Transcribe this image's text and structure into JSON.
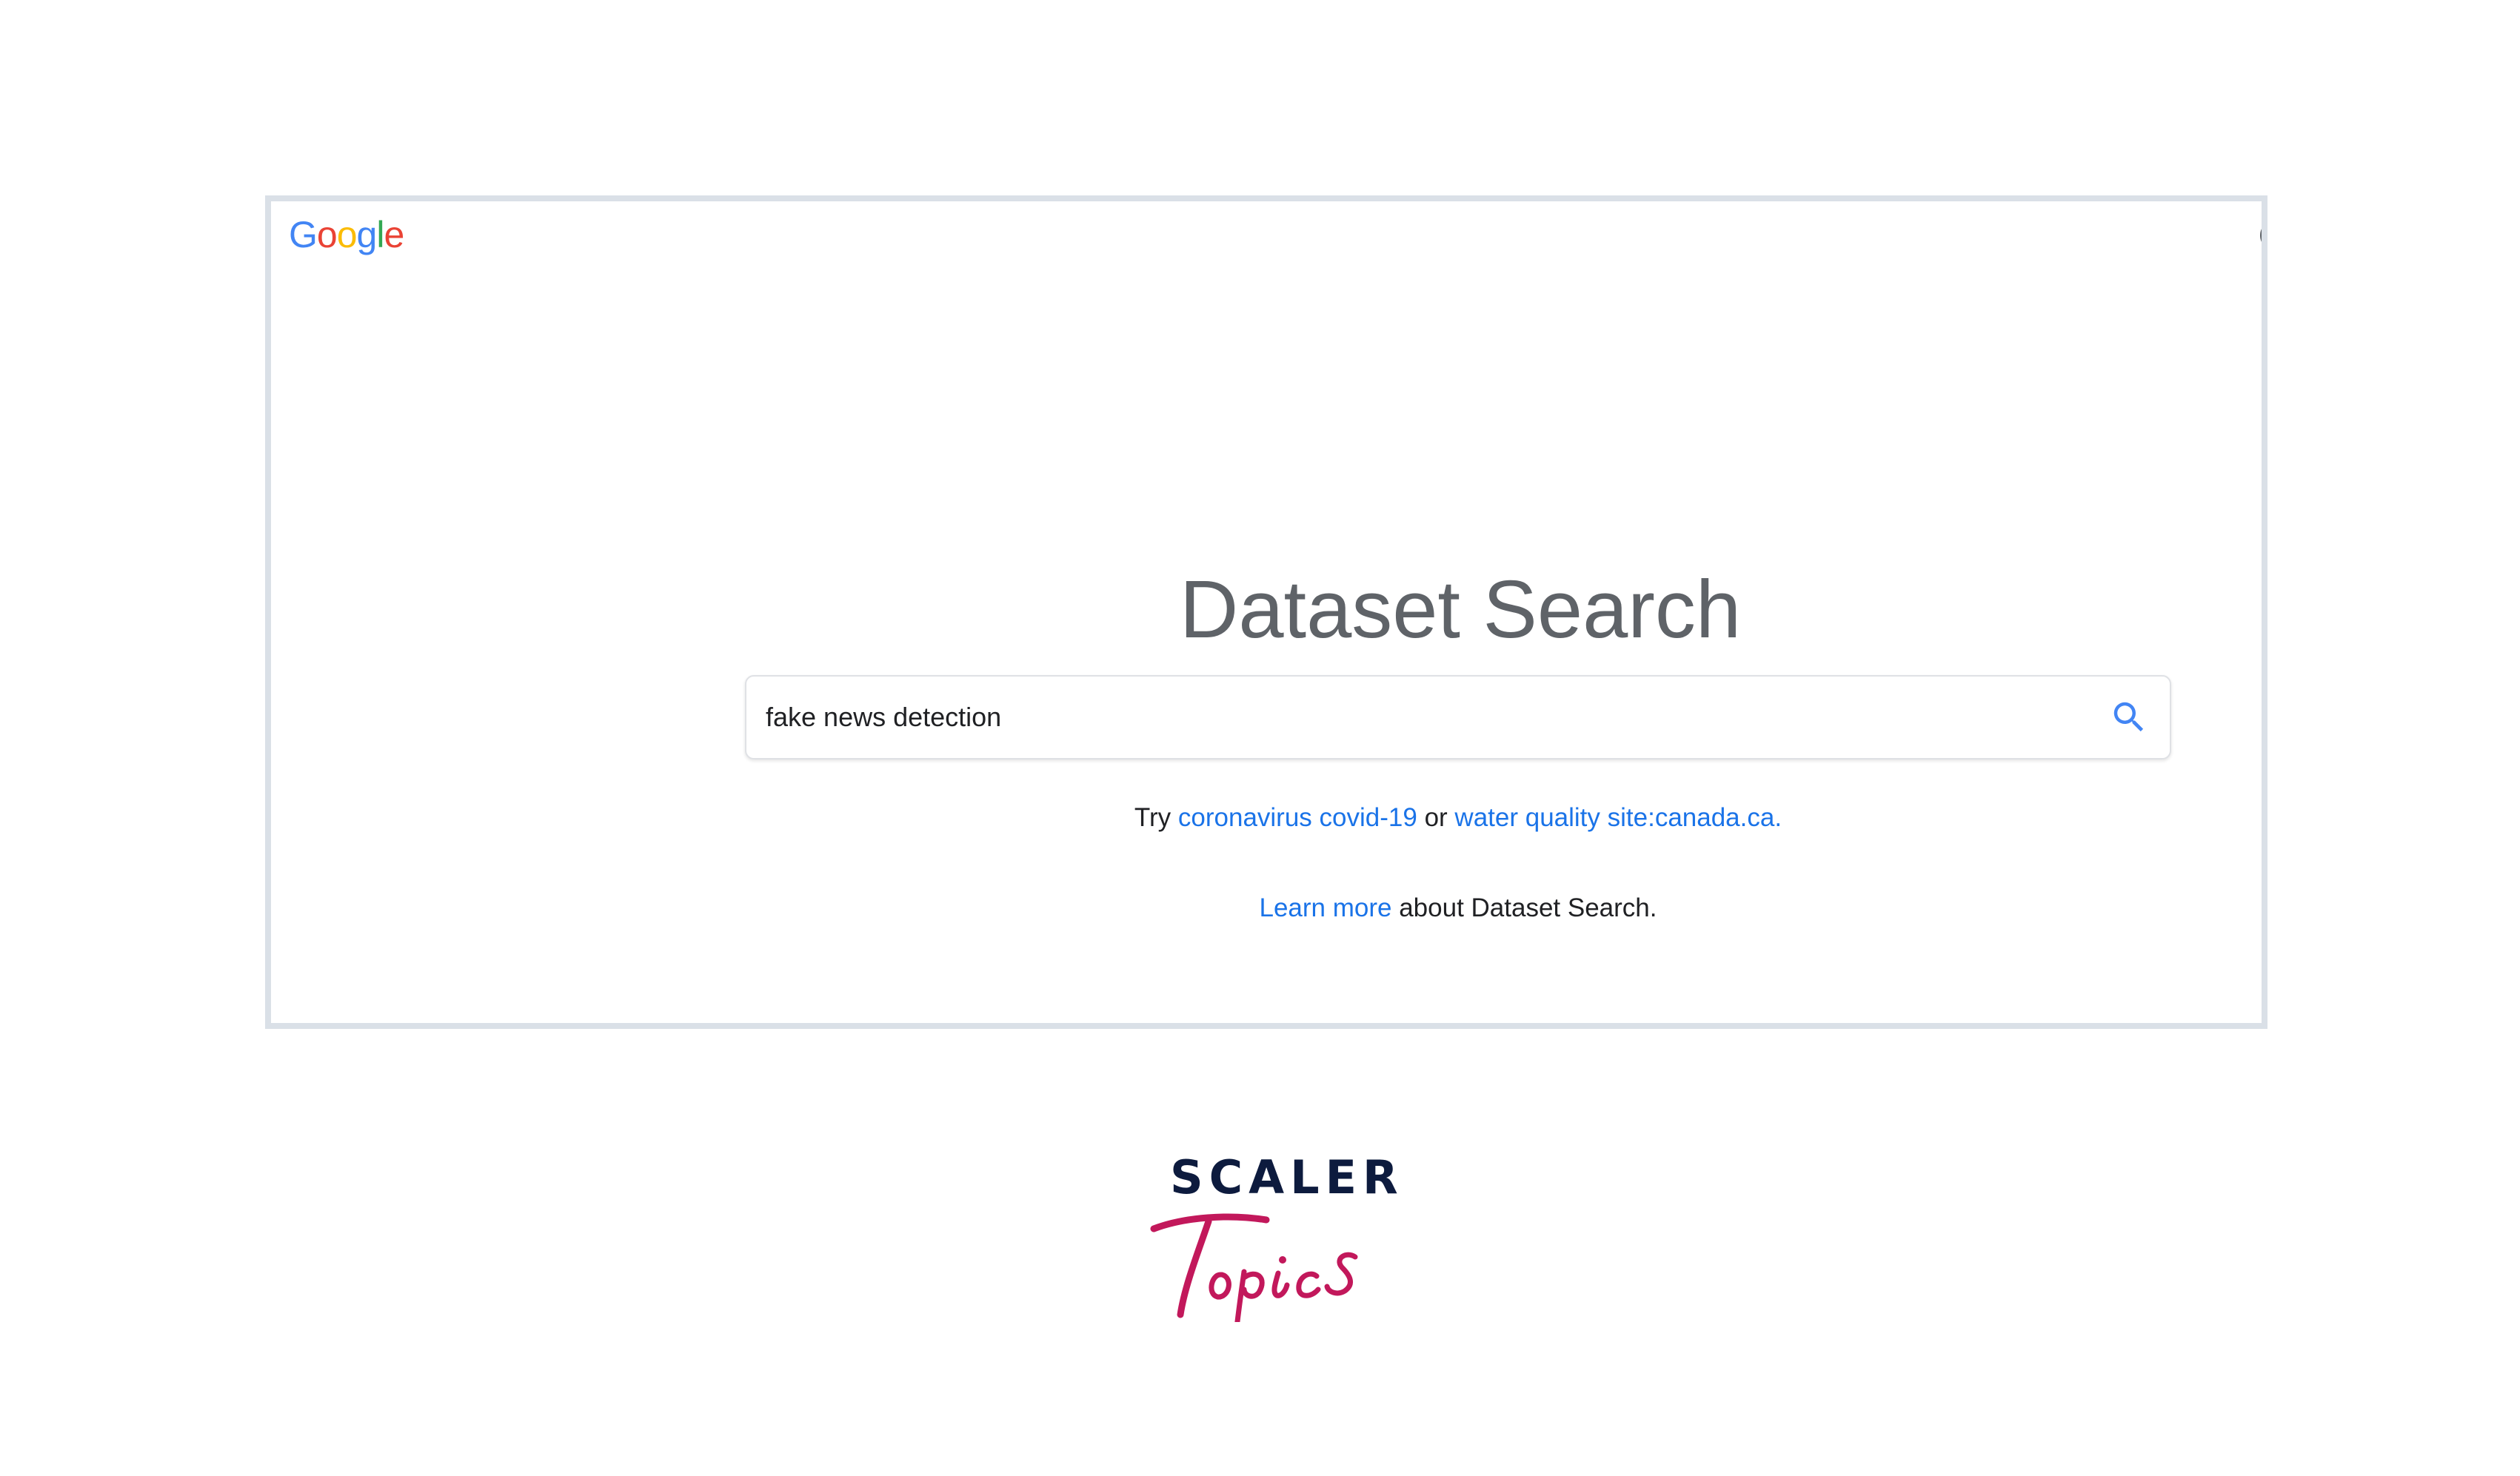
{
  "header": {
    "logo_letters": [
      {
        "char": "G",
        "color": "#4285F4"
      },
      {
        "char": "o",
        "color": "#EA4335"
      },
      {
        "char": "o",
        "color": "#FBBC05"
      },
      {
        "char": "g",
        "color": "#4285F4"
      },
      {
        "char": "l",
        "color": "#34A853"
      },
      {
        "char": "e",
        "color": "#EA4335"
      }
    ],
    "avatar_icon": "account-circle-icon"
  },
  "main": {
    "title": "Dataset Search",
    "search": {
      "value": "fake news detection",
      "icon": "search-icon",
      "icon_color": "#4285F4"
    },
    "suggestions": {
      "prefix": "Try",
      "link1": "coronavirus covid-19",
      "connector": "or",
      "link2": "water quality site:canada.ca",
      "suffix": "."
    },
    "learn": {
      "link": "Learn more",
      "suffix": "about Dataset Search."
    }
  },
  "brand": {
    "line1": "SCALER",
    "line2": "Topics",
    "line1_color": "#0d1b3e",
    "line2_color": "#c2185b"
  }
}
